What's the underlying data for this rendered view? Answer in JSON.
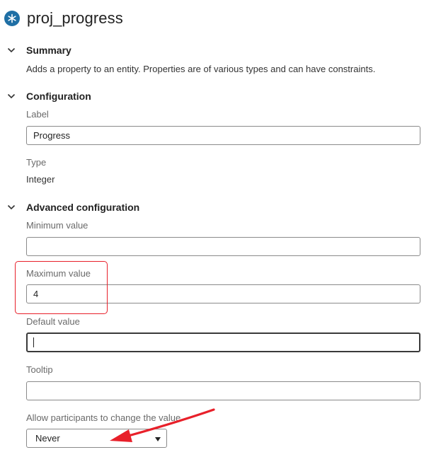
{
  "header": {
    "title": "proj_progress",
    "icon": "snowflake-icon",
    "icon_color": "#1f6fa5"
  },
  "summary": {
    "heading": "Summary",
    "description": "Adds a property to an entity. Properties are of various types and can have constraints."
  },
  "configuration": {
    "heading": "Configuration",
    "label_caption": "Label",
    "label_value": "Progress",
    "type_caption": "Type",
    "type_value": "Integer"
  },
  "advanced": {
    "heading": "Advanced configuration",
    "min_caption": "Minimum value",
    "min_value": "",
    "max_caption": "Maximum value",
    "max_value": "4",
    "default_caption": "Default value",
    "default_value": "",
    "tooltip_caption": "Tooltip",
    "tooltip_value": "",
    "allow_caption": "Allow participants to change the value",
    "allow_value": "Never"
  },
  "annotations": {
    "highlight_color": "#e8202a"
  }
}
